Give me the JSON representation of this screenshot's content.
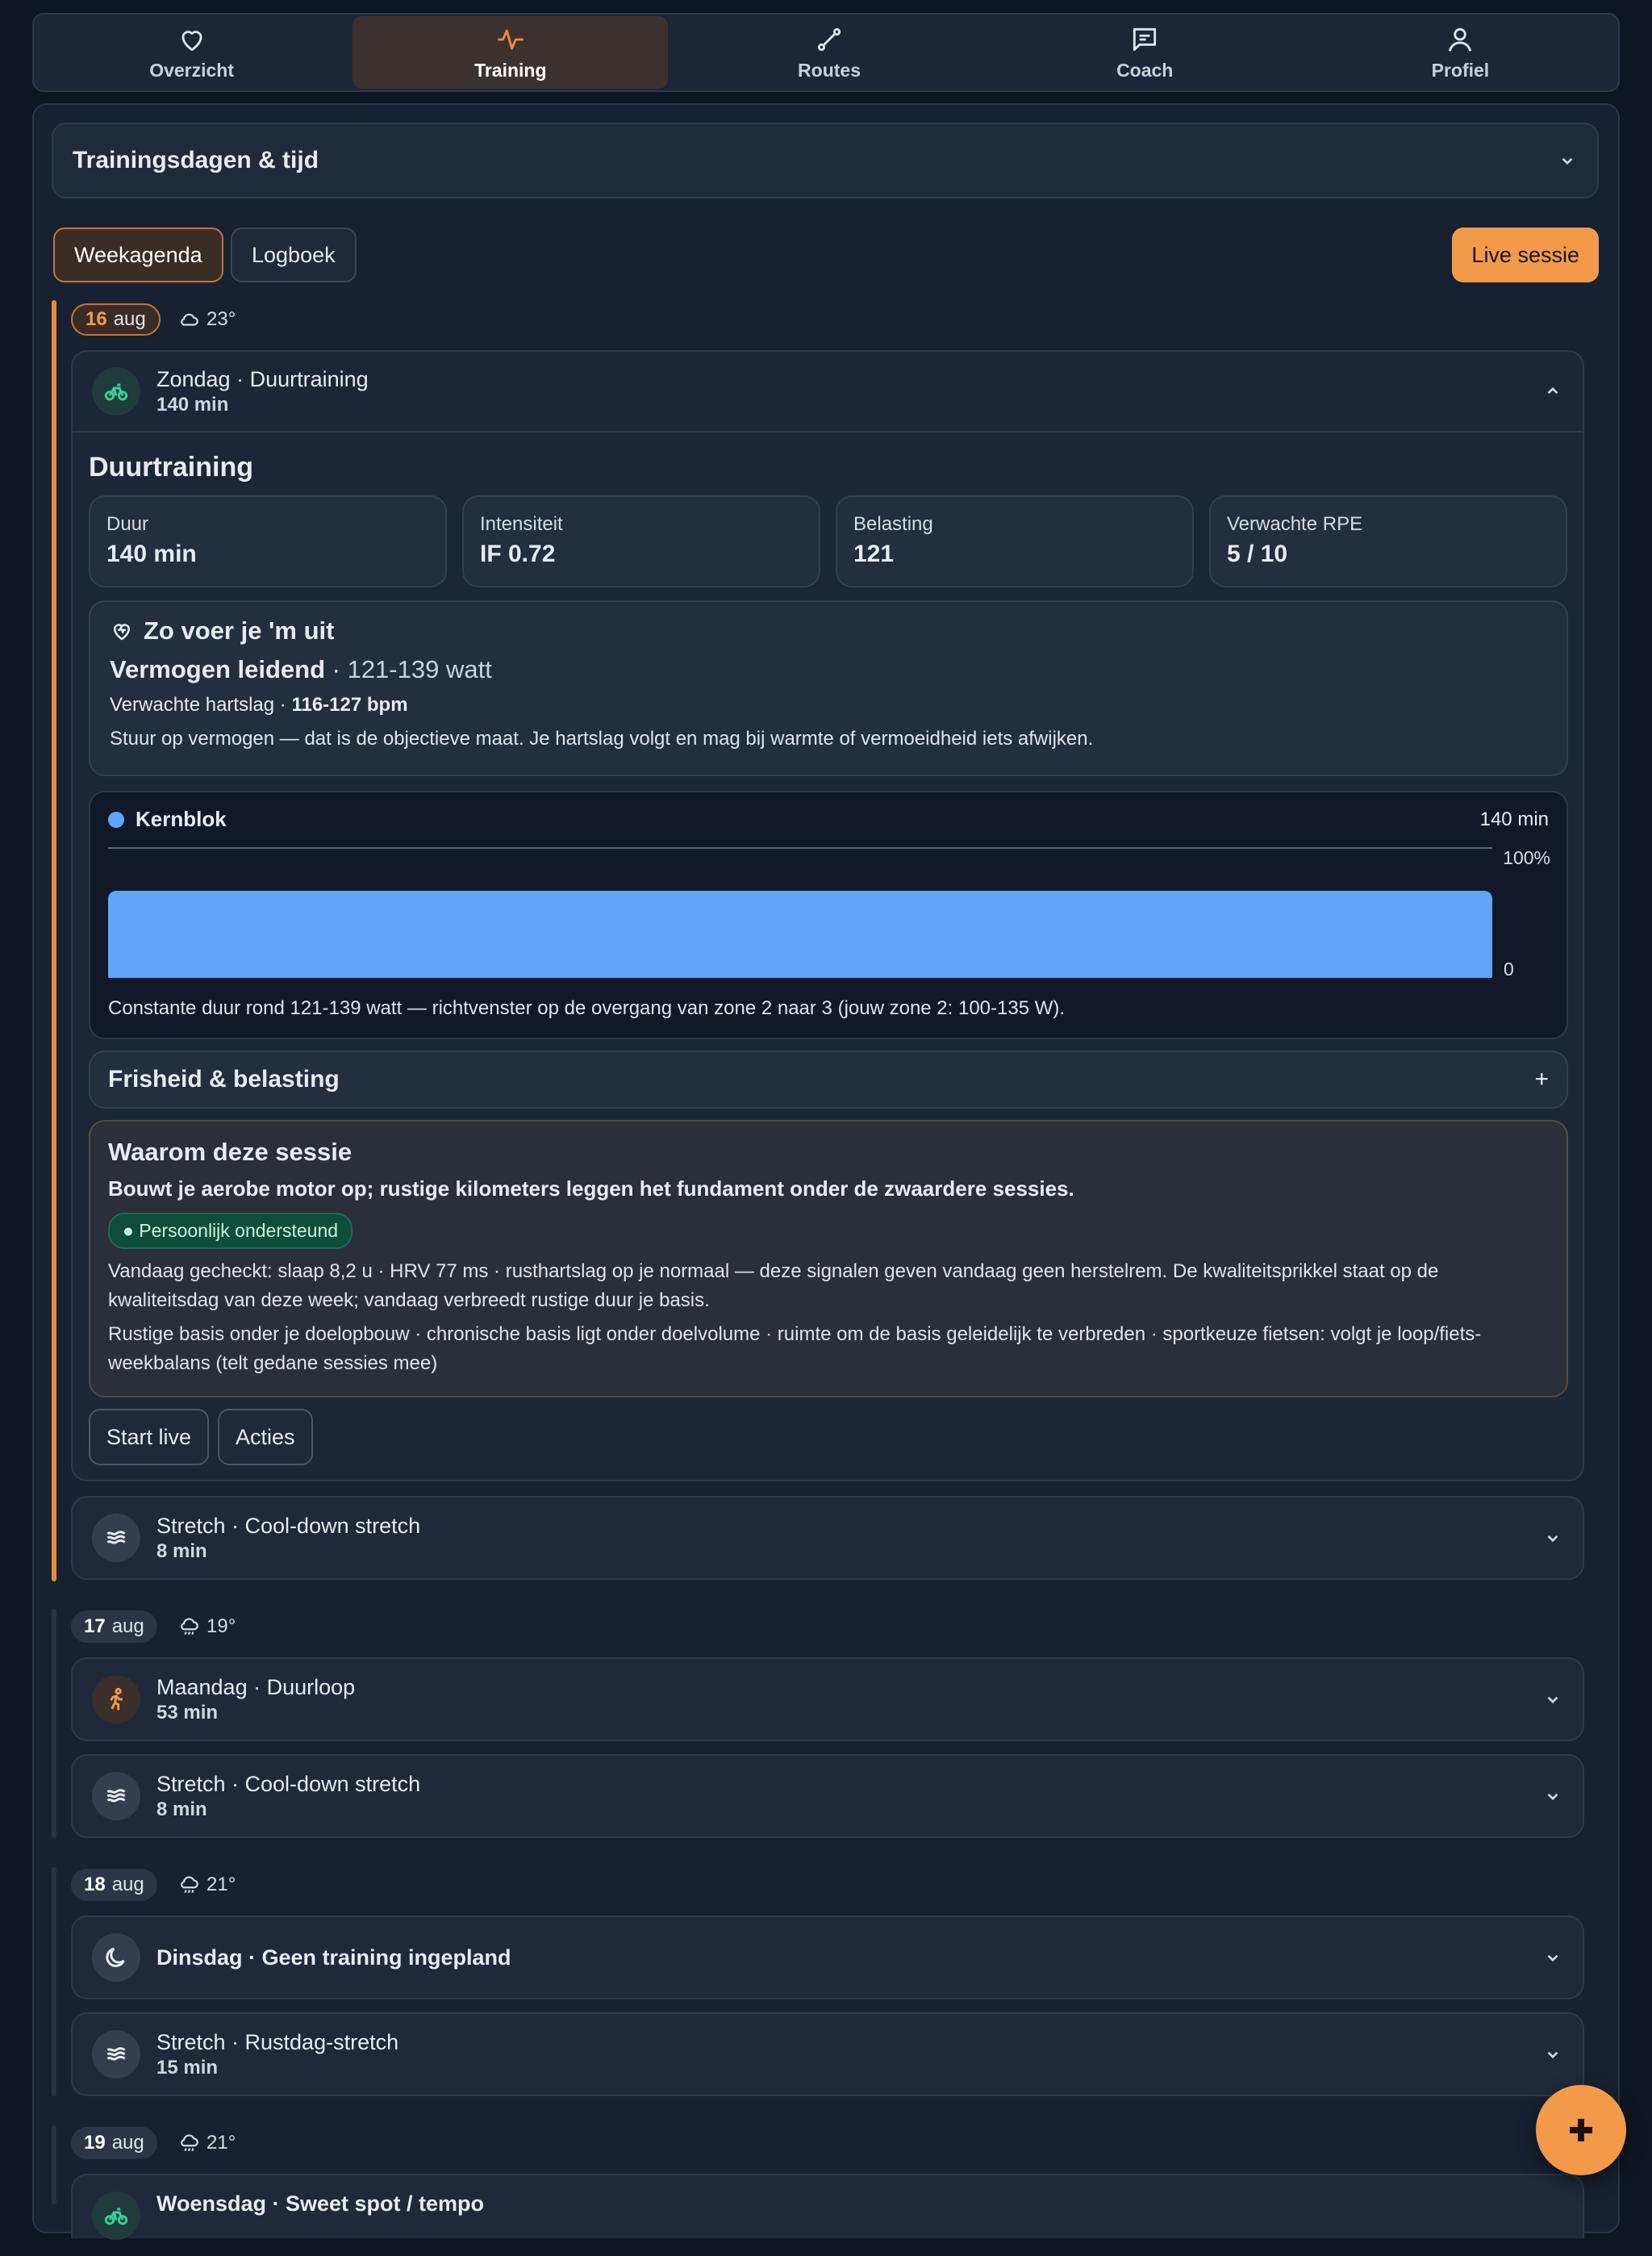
{
  "nav": {
    "tabs": [
      {
        "label": "Overzicht",
        "icon": "heart-icon"
      },
      {
        "label": "Training",
        "icon": "activity-icon",
        "active": true
      },
      {
        "label": "Routes",
        "icon": "route-icon"
      },
      {
        "label": "Coach",
        "icon": "chat-icon"
      },
      {
        "label": "Profiel",
        "icon": "user-icon"
      }
    ]
  },
  "section": {
    "title": "Trainingsdagen & tijd"
  },
  "view": {
    "agenda": "Weekagenda",
    "logbook": "Logboek",
    "live": "Live sessie"
  },
  "days": [
    {
      "day": "16",
      "month": "aug",
      "temp": "23°",
      "weather_icon": "cloud-icon",
      "sessions": [
        {
          "title": "Zondag · Duurtraining",
          "duration": "140 min",
          "icon": "bike-icon",
          "detail": {
            "title": "Duurtraining",
            "stats": [
              {
                "label": "Duur",
                "value": "140 min"
              },
              {
                "label": "Intensiteit",
                "value": "IF 0.72"
              },
              {
                "label": "Belasting",
                "value": "121"
              },
              {
                "label": "Verwachte RPE",
                "value": "5 / 10"
              }
            ],
            "how": {
              "title": "Zo voer je 'm uit",
              "power_label": "Vermogen leidend",
              "power_range": "121-139 watt",
              "hr_label": "Verwachte hartslag",
              "hr_range": "116-127 bpm",
              "note": "Stuur op vermogen — dat is de objectieve maat. Je hartslag volgt en mag bij warmte of vermoeidheid iets afwijken."
            },
            "block": {
              "name": "Kernblok",
              "duration": "140 min",
              "axis_max": "100%",
              "axis_min": "0",
              "fill_fraction": 1.0,
              "description": "Constante duur rond 121-139 watt — richtvenster op de overgang van zone 2 naar 3 (jouw zone 2: 100-135 W)."
            },
            "fresh": {
              "title": "Frisheid & belasting",
              "toggle": "+"
            },
            "why": {
              "title": "Waarom deze sessie",
              "summary": "Bouwt je aerobe motor op; rustige kilometers leggen het fundament onder de zwaardere sessies.",
              "badge": "● Persoonlijk ondersteund",
              "p1": "Vandaag gecheckt: slaap 8,2 u · HRV 77 ms · rusthartslag op je normaal — deze signalen geven vandaag geen herstelrem. De kwaliteitsprikkel staat op de kwaliteitsdag van deze week; vandaag verbreedt rustige duur je basis.",
              "p2": "Rustige basis onder je doelopbouw · chronische basis ligt onder doelvolume · ruimte om de basis geleidelijk te verbreden · sportkeuze fietsen: volgt je loop/fiets-weekbalans (telt gedane sessies mee)"
            },
            "actions": {
              "start": "Start live",
              "more": "Acties"
            }
          }
        },
        {
          "title": "Stretch · Cool-down stretch",
          "duration": "8 min",
          "icon": "stretch-icon"
        }
      ]
    },
    {
      "day": "17",
      "month": "aug",
      "temp": "19°",
      "weather_icon": "rain-icon",
      "sessions": [
        {
          "title": "Maandag · Duurloop",
          "duration": "53 min",
          "icon": "run-icon"
        },
        {
          "title": "Stretch · Cool-down stretch",
          "duration": "8 min",
          "icon": "stretch-icon"
        }
      ]
    },
    {
      "day": "18",
      "month": "aug",
      "temp": "21°",
      "weather_icon": "rain-icon",
      "sessions": [
        {
          "title": "Dinsdag · Geen training ingepland",
          "icon": "moon-icon"
        },
        {
          "title": "Stretch · Rustdag-stretch",
          "duration": "15 min",
          "icon": "stretch-icon"
        }
      ]
    },
    {
      "day": "19",
      "month": "aug",
      "temp": "21°",
      "weather_icon": "rain-icon",
      "sessions": [
        {
          "title": "Woensdag · Sweet spot / tempo",
          "icon": "bike-icon"
        }
      ]
    }
  ],
  "fab": {
    "icon": "plus-icon"
  },
  "colors": {
    "accent": "#f29a4a",
    "block": "#60a5fa",
    "badge_bg": "#0f4d3b"
  }
}
